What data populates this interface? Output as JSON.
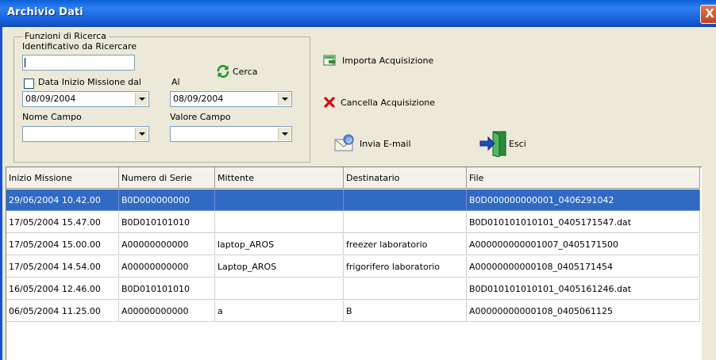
{
  "window": {
    "title": "Archivio Dati",
    "close_label": "X"
  },
  "search": {
    "group_title": "Funzioni di Ricerca",
    "id_label": "Identificativo da Ricercare",
    "id_value": "",
    "date_check_label": "Data Inizio Missione dal",
    "date_checked": false,
    "al_label": "Al",
    "date_from": "08/09/2004",
    "date_to": "08/09/2004",
    "field_name_label": "Nome Campo",
    "field_name_value": "",
    "field_value_label": "Valore Campo",
    "field_value_value": ""
  },
  "buttons": {
    "cerca": "Cerca",
    "importa": "Importa Acquisizione",
    "cancella": "Cancella Acquisizione",
    "email": "Invia E-mail",
    "esci": "Esci"
  },
  "icons": {
    "cerca": "refresh-icon",
    "importa": "import-icon",
    "cancella": "delete-x-icon",
    "email": "email-icon",
    "esci": "exit-door-icon"
  },
  "colors": {
    "selection": "#316ac5",
    "title_bar": "#1a66e0",
    "close": "#c4401f",
    "delete": "#d01010"
  },
  "table": {
    "headers": [
      "Inizio Missione",
      "Numero di Serie",
      "Mittente",
      "Destinatario",
      "File"
    ],
    "rows": [
      [
        "29/06/2004 10.42.00",
        "B0D000000000",
        "",
        "",
        "B0D000000000001_0406291042"
      ],
      [
        "17/05/2004 15.47.00",
        "B0D010101010",
        "",
        "",
        "B0D010101010101_0405171547.dat"
      ],
      [
        "17/05/2004 15.00.00",
        "A00000000000",
        "laptop_AROS",
        "freezer laboratorio",
        "A000000000001007_0405171500"
      ],
      [
        "17/05/2004 14.54.00",
        "A00000000000",
        "Laptop_AROS",
        "frigorifero laboratorio",
        "A00000000000108_0405171454"
      ],
      [
        "16/05/2004 12.46.00",
        "B0D010101010",
        "",
        "",
        "B0D010101010101_0405161246.dat"
      ],
      [
        "06/05/2004 11.25.00",
        "A00000000000",
        "a",
        "B",
        "A00000000000108_0405061125"
      ]
    ],
    "selected_row": 0
  }
}
